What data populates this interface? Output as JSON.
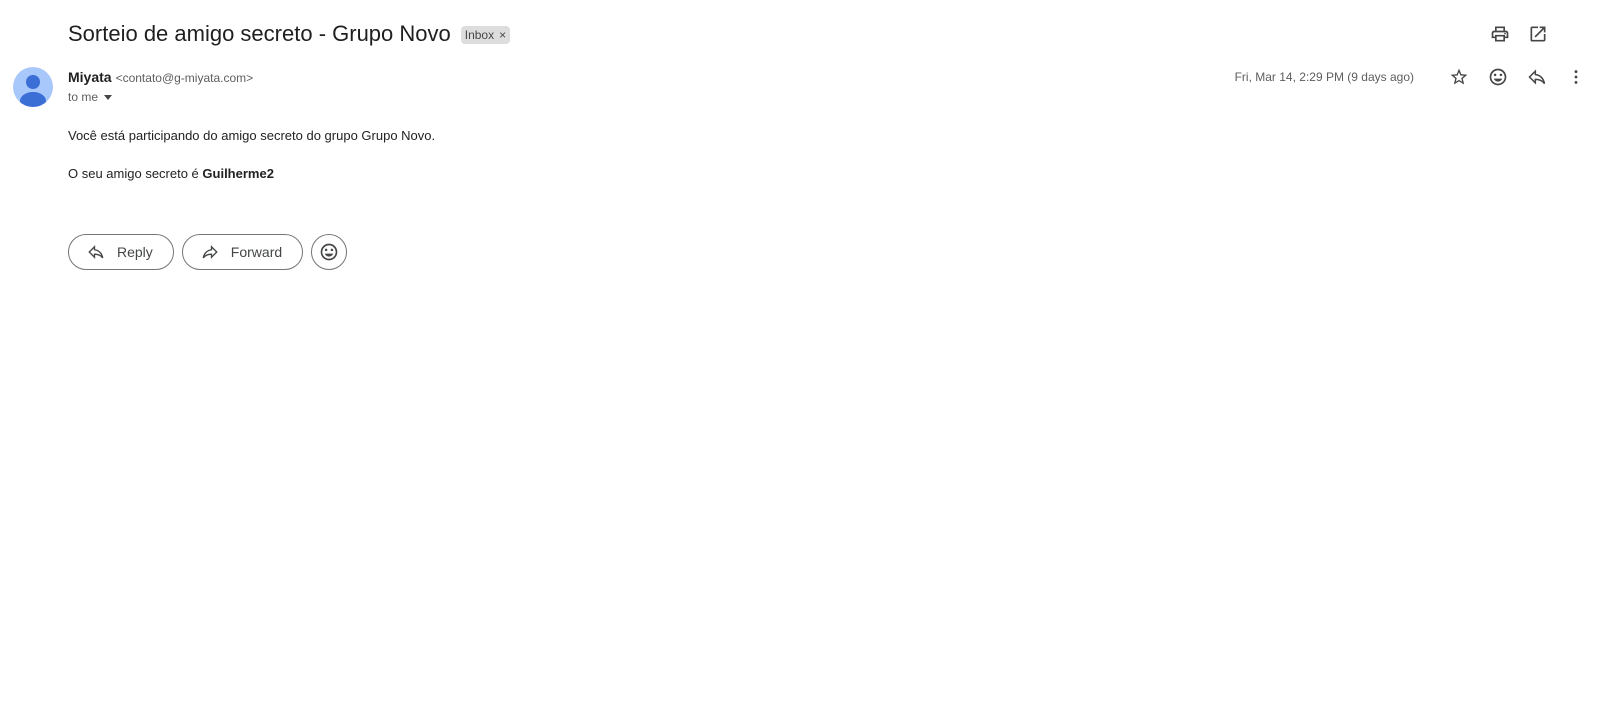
{
  "email": {
    "subject": "Sorteio de amigo secreto - Grupo Novo",
    "label": "Inbox",
    "label_remove": "×",
    "sender_name": "Miyata",
    "sender_email": "<contato@g-miyata.com>",
    "recipient": "to me",
    "date": "Fri, Mar 14, 2:29 PM (9 days ago)",
    "body": {
      "line1": "Você está participando do amigo secreto do grupo Grupo Novo.",
      "line2_prefix": "O seu amigo secreto é ",
      "line2_name": "Guilherme2"
    }
  },
  "actions": {
    "reply_label": "Reply",
    "forward_label": "Forward"
  },
  "icons": {
    "top": [
      "print-icon",
      "open-in-new-window-icon"
    ],
    "meta": [
      "star-icon",
      "emoji-icon",
      "reply-icon",
      "more-vert-icon"
    ]
  },
  "colors": {
    "avatar_bg": "#a8c7fa",
    "avatar_fg": "#3b6fd6",
    "chip_bg": "#dddddd"
  }
}
